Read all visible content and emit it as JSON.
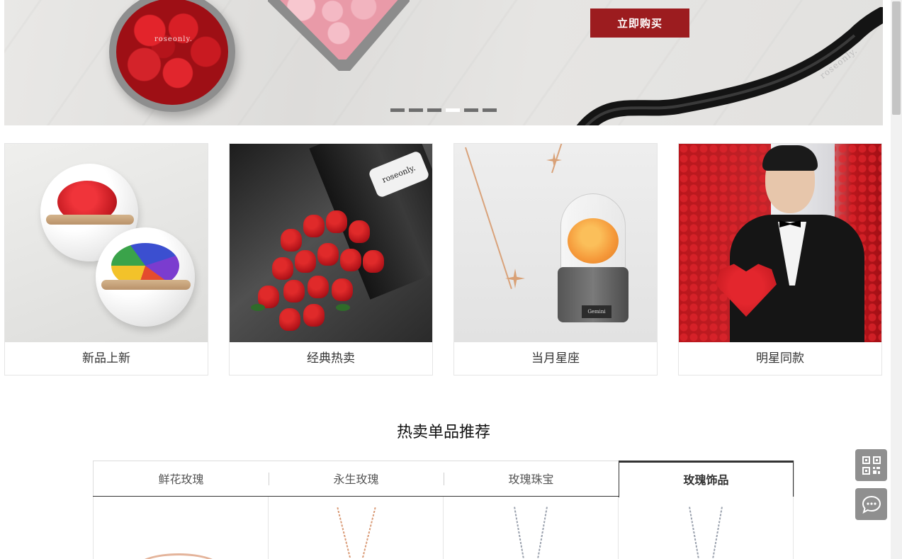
{
  "banner": {
    "buy_label": "立即购买",
    "brand_text": "roseonly.",
    "ribbon_text": "roseonly.",
    "slide_count": 6,
    "active_slide": 4
  },
  "categories": [
    {
      "label": "新品上新"
    },
    {
      "label": "经典热卖"
    },
    {
      "label": "当月星座"
    },
    {
      "label": "明星同款"
    }
  ],
  "product_images": {
    "tag_text": "roseonly.",
    "plate_text": "Gemini"
  },
  "section": {
    "title": "热卖单品推荐"
  },
  "tabs": [
    {
      "label": "鲜花玫瑰",
      "active": false
    },
    {
      "label": "永生玫瑰",
      "active": false
    },
    {
      "label": "玫瑰珠宝",
      "active": false
    },
    {
      "label": "玫瑰饰品",
      "active": true
    }
  ],
  "side_buttons": {
    "qr_icon": "qr-code-icon",
    "chat_icon": "chat-bubble-icon"
  },
  "colors": {
    "accent": "#9c1c1f",
    "side_button": "#8f8f8f"
  }
}
